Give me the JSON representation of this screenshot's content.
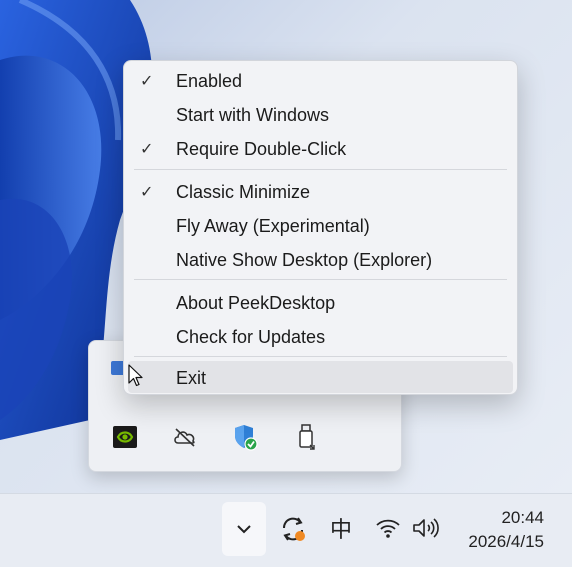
{
  "context_menu": {
    "items": [
      {
        "label": "Enabled",
        "checked": true
      },
      {
        "label": "Start with Windows",
        "checked": false
      },
      {
        "label": "Require Double-Click",
        "checked": true
      },
      {
        "label": "Classic Minimize",
        "checked": true
      },
      {
        "label": "Fly Away (Experimental)",
        "checked": false
      },
      {
        "label": "Native Show Desktop (Explorer)",
        "checked": false
      },
      {
        "label": "About PeekDesktop",
        "checked": false
      },
      {
        "label": "Check for Updates",
        "checked": false
      },
      {
        "label": "Exit",
        "checked": false,
        "hovered": true
      }
    ],
    "check_glyph": "✓"
  },
  "tray_flyout": {
    "icons": [
      "app-icon",
      "nvidia-icon",
      "cloud-off-icon",
      "windows-security-icon",
      "usb-drive-icon"
    ]
  },
  "taskbar": {
    "overflow_glyph": "⌄",
    "ime_label": "中",
    "time": "20:44",
    "date": "2026/4/15"
  },
  "colors": {
    "wallpaper_blue": "#1f4fc4",
    "menu_bg": "#f2f3f6",
    "nvidia_green": "#76b900",
    "defender_blue": "#2f7fd6",
    "status_green": "#2aa44a",
    "sync_orange": "#f08a24"
  }
}
